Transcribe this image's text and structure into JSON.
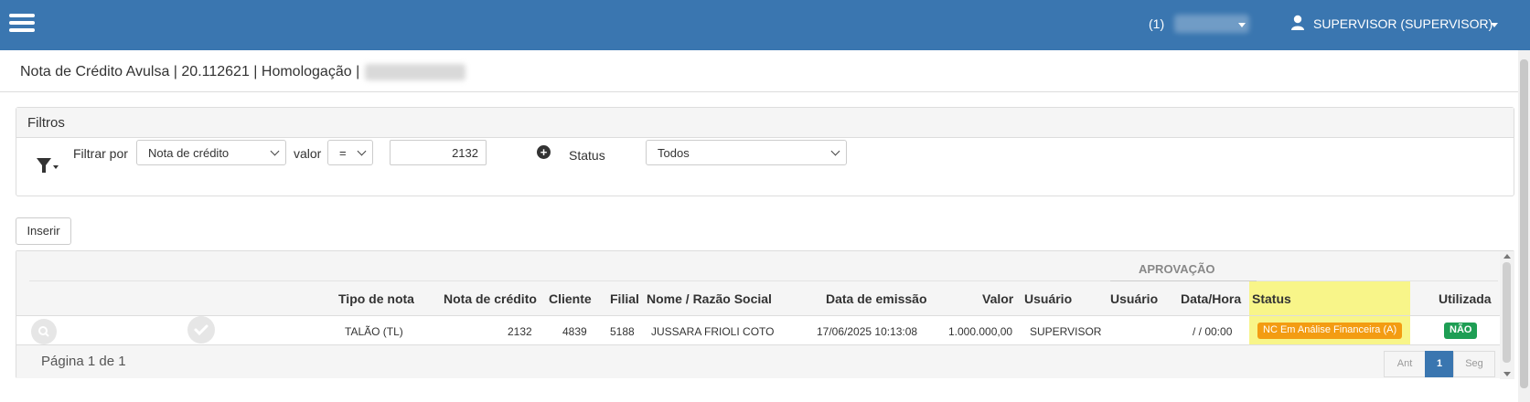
{
  "header": {
    "context_prefix": "(1)",
    "user_label": "SUPERVISOR (SUPERVISOR)"
  },
  "page": {
    "title": "Nota de Crédito Avulsa | 20.112621 | Homologação |"
  },
  "filters": {
    "panel_title": "Filtros",
    "filter_by_label": "Filtrar por",
    "filter_field": "Nota de crédito",
    "value_label": "valor",
    "operator": "=",
    "value": "2132",
    "status_label": "Status",
    "status_value": "Todos"
  },
  "toolbar": {
    "insert_label": "Inserir"
  },
  "table": {
    "group_header": "APROVAÇÃO",
    "columns": {
      "tipo": "Tipo de nota",
      "nota": "Nota de crédito",
      "cliente": "Cliente",
      "filial": "Filial",
      "nome": "Nome / Razão Social",
      "data_emissao": "Data de emissão",
      "valor": "Valor",
      "usuario": "Usuário",
      "aprov_usuario": "Usuário",
      "aprov_data": "Data/Hora",
      "status": "Status",
      "utilizada": "Utilizada"
    },
    "rows": [
      {
        "tipo": "TALÃO (TL)",
        "nota": "2132",
        "cliente": "4839",
        "filial": "5188",
        "nome": "JUSSARA FRIOLI COTO",
        "data_emissao": "17/06/2025 10:13:08",
        "valor": "1.000.000,00",
        "usuario": "SUPERVISOR",
        "aprov_usuario": "",
        "aprov_data": "/ / 00:00",
        "status": "NC Em Análise Financeira (A)",
        "utilizada": "NÃO"
      }
    ],
    "page_info": "Página 1 de 1",
    "pager": {
      "prev": "Ant",
      "current": "1",
      "next": "Seg"
    }
  },
  "colors": {
    "topbar": "#3a76b0",
    "status_badge": "#f39c12",
    "utilizada_badge": "#1e9e54",
    "status_highlight": "#f8f589"
  }
}
